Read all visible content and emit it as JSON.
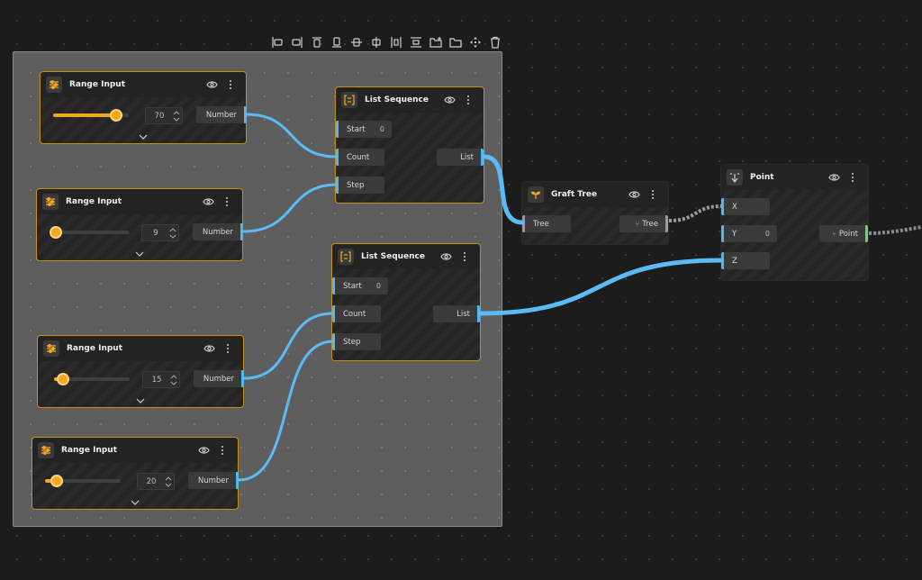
{
  "toolbar": {
    "icons": [
      "align-left-icon",
      "align-hcenter-icon",
      "align-right-icon",
      "align-top-icon",
      "align-vcenter-icon",
      "align-bottom-icon",
      "distribute-h-icon",
      "distribute-v-icon",
      "add-folder-icon",
      "folder-icon",
      "move-icon",
      "trash-icon"
    ]
  },
  "range_inputs": [
    {
      "title": "Range Input",
      "value": "70",
      "fraction": 0.83,
      "output": "Number"
    },
    {
      "title": "Range Input",
      "value": "9",
      "fraction": 0.04,
      "output": "Number"
    },
    {
      "title": "Range Input",
      "value": "15",
      "fraction": 0.12,
      "output": "Number"
    },
    {
      "title": "Range Input",
      "value": "20",
      "fraction": 0.16,
      "output": "Number"
    }
  ],
  "list_sequences": [
    {
      "title": "List Sequence",
      "start_label": "Start",
      "start_value": "0",
      "count_label": "Count",
      "step_label": "Step",
      "output": "List"
    },
    {
      "title": "List Sequence",
      "start_label": "Start",
      "start_value": "0",
      "count_label": "Count",
      "step_label": "Step",
      "output": "List"
    }
  ],
  "graft_tree": {
    "title": "Graft Tree",
    "input": "Tree",
    "output": "Tree"
  },
  "point": {
    "title": "Point",
    "x_label": "X",
    "y_label": "Y",
    "y_value": "0",
    "z_label": "Z",
    "output": "Point"
  },
  "colors": {
    "accent": "#f5a623",
    "wire": "#5bbcf5",
    "node_border": "#c98d14",
    "output_ok": "#6ad46a"
  }
}
